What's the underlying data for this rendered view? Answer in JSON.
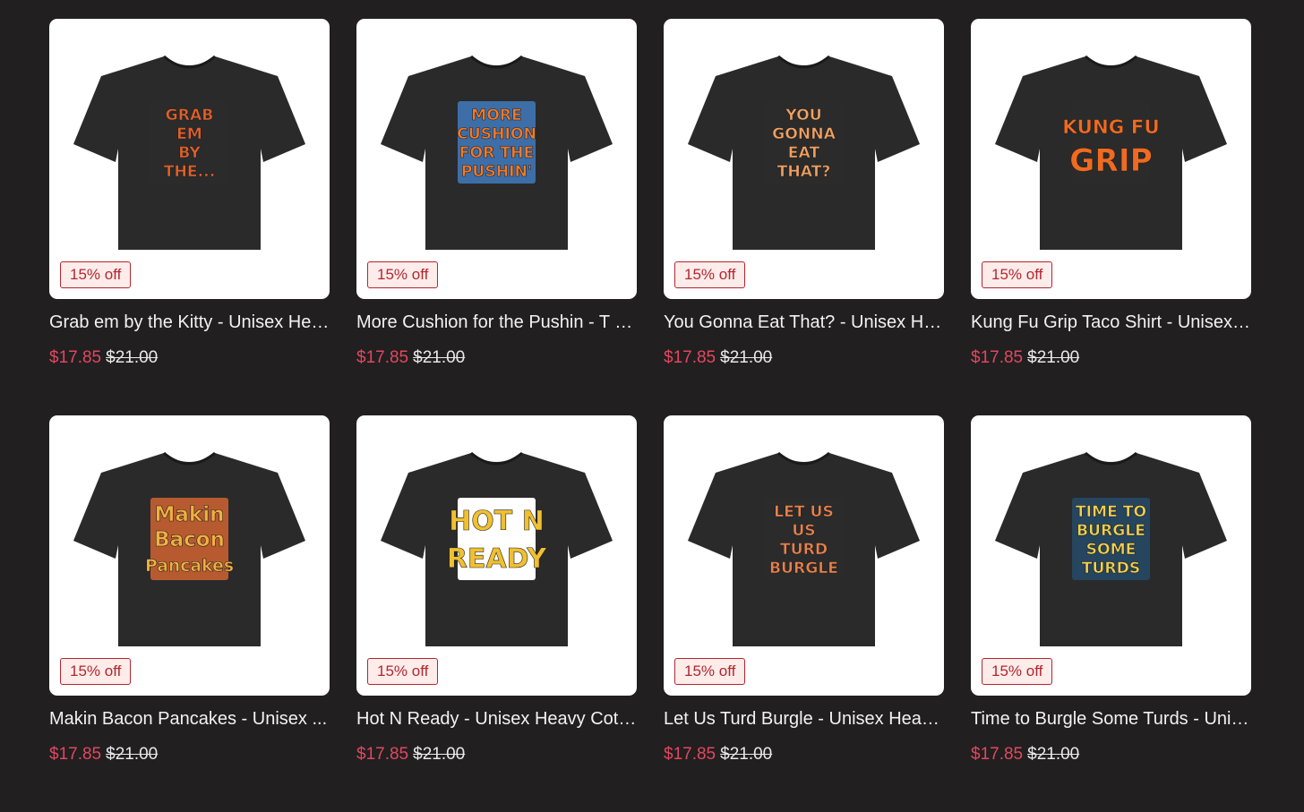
{
  "products": [
    {
      "title": "Grab em by the Kitty - Unisex Hea...",
      "badge": "15% off",
      "sale_price": "$17.85",
      "original_price": "$21.00",
      "art_lines": [
        "GRAB",
        "EM",
        "BY",
        "THE..."
      ],
      "art_color": "#e0602a",
      "art_bg": "#2b2b2b"
    },
    {
      "title": "More Cushion for the Pushin - T S...",
      "badge": "15% off",
      "sale_price": "$17.85",
      "original_price": "$21.00",
      "art_lines": [
        "MORE",
        "CUSHION",
        "FOR THE",
        "PUSHIN'"
      ],
      "art_color": "#f07a2a",
      "art_bg": "#3d6ea8"
    },
    {
      "title": "You Gonna Eat That? - Unisex He...",
      "badge": "15% off",
      "sale_price": "$17.85",
      "original_price": "$21.00",
      "art_lines": [
        "YOU",
        "GONNA",
        "EAT",
        "THAT?"
      ],
      "art_color": "#f0a060",
      "art_bg": "#2b2b2b"
    },
    {
      "title": "Kung Fu Grip Taco Shirt - Unisex ...",
      "badge": "15% off",
      "sale_price": "$17.85",
      "original_price": "$21.00",
      "art_lines": [
        "KUNG FU",
        "GRIP"
      ],
      "art_color": "#f06a20",
      "art_bg": "#2b2b2b"
    },
    {
      "title": "Makin Bacon Pancakes - Unisex ...",
      "badge": "15% off",
      "sale_price": "$17.85",
      "original_price": "$21.00",
      "art_lines": [
        "Makin",
        "Bacon",
        "Pancakes"
      ],
      "art_color": "#f0b040",
      "art_bg": "#b85a30"
    },
    {
      "title": "Hot N Ready - Unisex Heavy Cott...",
      "badge": "15% off",
      "sale_price": "$17.85",
      "original_price": "$21.00",
      "art_lines": [
        "HOT N",
        "READY"
      ],
      "art_color": "#f0c030",
      "art_bg": "#ffffff"
    },
    {
      "title": "Let Us Turd Burgle - Unisex Heavy...",
      "badge": "15% off",
      "sale_price": "$17.85",
      "original_price": "$21.00",
      "art_lines": [
        "LET US",
        "US",
        "TURD",
        "BURGLE"
      ],
      "art_color": "#e8804a",
      "art_bg": "#2b2b2b"
    },
    {
      "title": "Time to Burgle Some Turds - Unis...",
      "badge": "15% off",
      "sale_price": "$17.85",
      "original_price": "$21.00",
      "art_lines": [
        "TIME TO",
        "BURGLE",
        "SOME",
        "TURDS"
      ],
      "art_color": "#f0d050",
      "art_bg": "#26455e"
    }
  ],
  "colors": {
    "page_bg": "#211f20",
    "shirt": "#2a2a2a",
    "sale_price": "#e0485f",
    "badge_border": "#b3262f",
    "badge_bg": "#fdecea"
  },
  "icons": [
    "tshirt-icon"
  ]
}
